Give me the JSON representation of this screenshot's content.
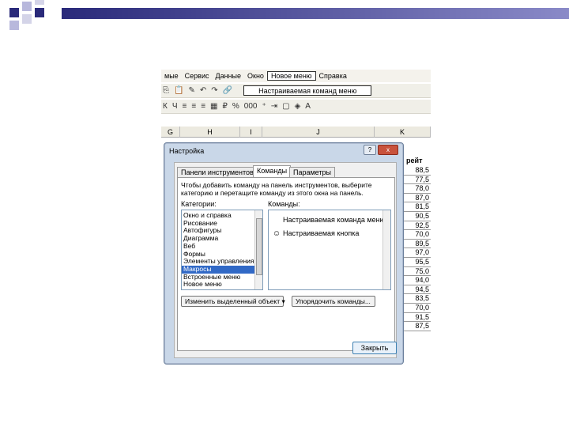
{
  "menubar": {
    "items": [
      "мые",
      "Сервис",
      "Данные",
      "Окно",
      "Новое меню",
      "Справка"
    ]
  },
  "toolbar2": {
    "custom_command_label": "Настраиваемая команд меню"
  },
  "sheet": {
    "columns": [
      "G",
      "H",
      "I",
      "J",
      "K"
    ],
    "header_fragment": "й рейт",
    "values": [
      "88,5",
      "77,5",
      "78,0",
      "87,0",
      "81,5",
      "90,5",
      "92,5",
      "70,0",
      "89,5",
      "97,0",
      "95,5",
      "75,0",
      "94,0",
      "94,5",
      "83,5",
      "70,0",
      "91,5",
      "87,5"
    ]
  },
  "dialog": {
    "title": "Настройка",
    "help_label": "?",
    "close_label": "x",
    "tabs": [
      "Панели инструментов",
      "Команды",
      "Параметры"
    ],
    "description": "Чтобы добавить команду на панель инструментов, выберите категорию и перетащите команду из этого окна на панель.",
    "categories_label": "Категории:",
    "commands_label": "Команды:",
    "categories": [
      "Окно и справка",
      "Рисование",
      "Автофигуры",
      "Диаграмма",
      "Веб",
      "Формы",
      "Элементы управления",
      "Макросы",
      "Встроенные меню",
      "Новое меню"
    ],
    "selected_category": "Макросы",
    "commands": [
      "Настраиваемая команда меню",
      "Настраиваемая кнопка"
    ],
    "modify_selection_button": "Изменить выделенный объект ▾",
    "rearrange_button": "Упорядочить команды...",
    "close_button": "Закрыть"
  }
}
